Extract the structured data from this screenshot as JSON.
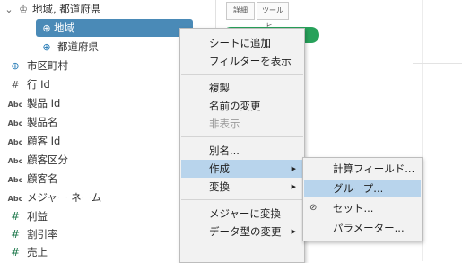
{
  "data_pane": {
    "items": [
      {
        "icon": "hierarchy-icon",
        "glyph": "♔",
        "label": "地域, 都道府県",
        "type": "hierarchy"
      },
      {
        "icon": "globe-icon",
        "glyph": "⊕",
        "label": "地域",
        "type": "geo",
        "selected": true
      },
      {
        "icon": "globe-icon",
        "glyph": "⊕",
        "label": "都道府県",
        "type": "geo"
      },
      {
        "icon": "globe-link-icon",
        "glyph": "⊕",
        "label": "市区町村",
        "type": "geo"
      },
      {
        "icon": "number-icon",
        "glyph": "#",
        "label": "行 Id",
        "type": "number"
      },
      {
        "icon": "string-icon",
        "glyph": "Abc",
        "label": "製品 Id",
        "type": "string"
      },
      {
        "icon": "string-icon",
        "glyph": "Abc",
        "label": "製品名",
        "type": "string"
      },
      {
        "icon": "string-icon",
        "glyph": "Abc",
        "label": "顧客 Id",
        "type": "string"
      },
      {
        "icon": "string-icon",
        "glyph": "Abc",
        "label": "顧客区分",
        "type": "string"
      },
      {
        "icon": "string-icon",
        "glyph": "Abc",
        "label": "顧客名",
        "type": "string"
      },
      {
        "icon": "string-icon",
        "glyph": "Abc",
        "label": "メジャー ネーム",
        "type": "string"
      },
      {
        "icon": "number-icon",
        "glyph": "#",
        "label": "利益",
        "type": "measure"
      },
      {
        "icon": "number-icon",
        "glyph": "#",
        "label": "割引率",
        "type": "measure"
      },
      {
        "icon": "number-icon",
        "glyph": "#",
        "label": "売上",
        "type": "measure"
      }
    ]
  },
  "shelf": {
    "detail_label": "詳細",
    "tooltip_label": "ツールヒ…"
  },
  "context_menu": {
    "items": [
      {
        "label": "シートに追加"
      },
      {
        "label": "フィルターを表示"
      },
      {
        "label": "複製"
      },
      {
        "label": "名前の変更"
      },
      {
        "label": "非表示",
        "disabled": true
      },
      {
        "label": "別名..."
      },
      {
        "label": "作成",
        "submenu": true,
        "highlighted": true
      },
      {
        "label": "変換",
        "submenu": true
      },
      {
        "label": "メジャーに変換"
      },
      {
        "label": "データ型の変更",
        "submenu": true
      }
    ],
    "submenu": {
      "items": [
        {
          "label": "計算フィールド..."
        },
        {
          "label": "グループ...",
          "highlighted": true
        },
        {
          "label": "セット...",
          "icon": "set-icon"
        },
        {
          "label": "パラメーター..."
        }
      ]
    }
  },
  "colors": {
    "selected_row": "#4a8ab7",
    "menu_highlight": "#b8d4ec",
    "pill_green": "#27a15a"
  }
}
